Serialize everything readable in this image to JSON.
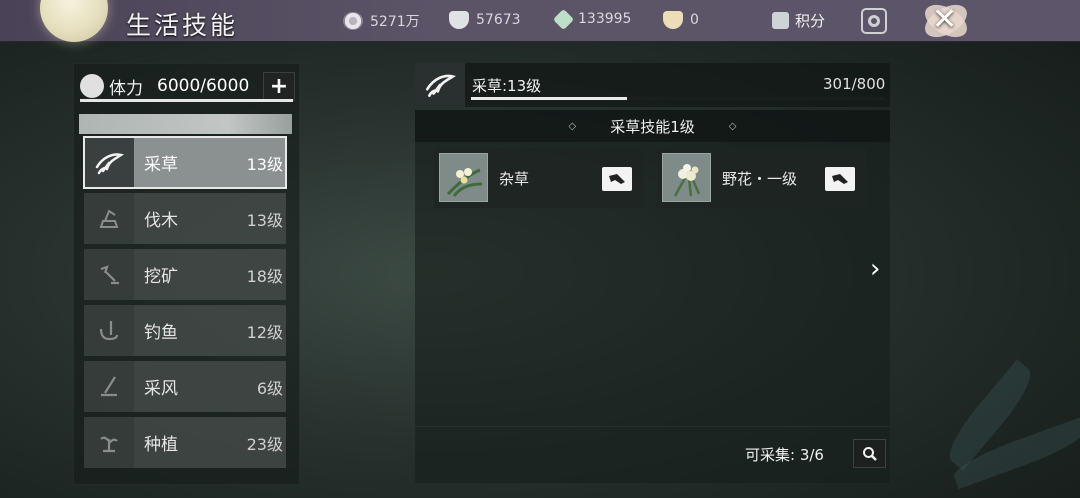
{
  "header": {
    "title": "生活技能",
    "currencies": [
      {
        "icon": "coin-wheel-icon",
        "value": "5271万"
      },
      {
        "icon": "silver-bowl-icon",
        "value": "57673"
      },
      {
        "icon": "jade-gem-icon",
        "value": "133995"
      },
      {
        "icon": "gold-bowl-icon",
        "value": "0"
      }
    ],
    "score_label": "积分"
  },
  "stamina": {
    "label": "体力",
    "value": "6000/6000",
    "plus": "+"
  },
  "skills": [
    {
      "name": "采草",
      "level": "13级",
      "icon": "herb-picking-icon"
    },
    {
      "name": "伐木",
      "level": "13级",
      "icon": "woodcutting-icon"
    },
    {
      "name": "挖矿",
      "level": "18级",
      "icon": "mining-icon"
    },
    {
      "name": "钓鱼",
      "level": "12级",
      "icon": "fishing-icon"
    },
    {
      "name": "采风",
      "level": "6级",
      "icon": "sightseeing-icon"
    },
    {
      "name": "种植",
      "level": "23级",
      "icon": "planting-icon"
    }
  ],
  "selected_skill": {
    "title": "采草:13级",
    "progress": "301/800",
    "progress_fraction": 0.376
  },
  "section": {
    "title": "采草技能1级",
    "items": [
      {
        "name": "杂草",
        "icon": "grass-plant-icon"
      },
      {
        "name": "野花・一级",
        "icon": "wildflower-icon"
      }
    ]
  },
  "footer": {
    "collect_label": "可采集: 3/6"
  },
  "colors": {
    "topbar": "#5b5366",
    "panel": "#161e1b",
    "selected_item": "#8a9190"
  }
}
